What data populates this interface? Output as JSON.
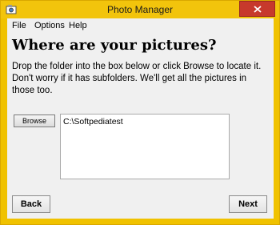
{
  "window": {
    "title": "Photo Manager"
  },
  "menu": {
    "items": [
      "File",
      "Options",
      "Help"
    ]
  },
  "content": {
    "heading": "Where are your pictures?",
    "instructions": "Drop the folder into the box below or click Browse to locate it.  Don't worry if it has subfolders.  We'll get all the pictures in those too.",
    "browse_label": "Browse",
    "folder_path": "C:\\Softpediatest"
  },
  "footer": {
    "back_label": "Back",
    "next_label": "Next"
  },
  "icons": {
    "app": "photo-manager-app-icon",
    "close": "close-icon"
  },
  "colors": {
    "titlebar": "#f2c40c",
    "close_button": "#c7392c",
    "client_background": "#f0f0f0"
  }
}
